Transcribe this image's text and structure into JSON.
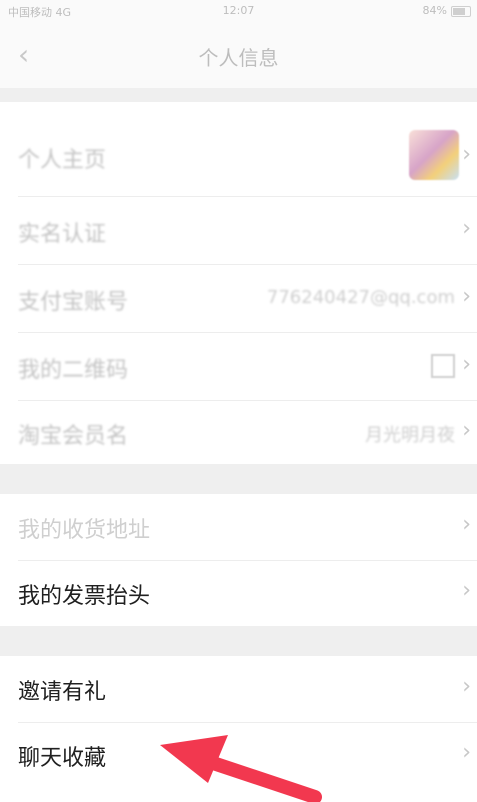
{
  "status": {
    "carrier": "中国移动 4G",
    "time": "12:07",
    "battery": "84%"
  },
  "nav": {
    "title": "个人信息"
  },
  "profile_rows": [
    {
      "label": "个人主页",
      "value": ""
    },
    {
      "label": "实名认证",
      "value": ""
    },
    {
      "label": "支付宝账号",
      "value": "776240427@qq.com"
    },
    {
      "label": "我的二维码",
      "value": ""
    },
    {
      "label": "淘宝会员名",
      "value": "月光明月夜"
    }
  ],
  "address_rows": [
    {
      "label": "我的收货地址"
    },
    {
      "label": "我的发票抬头"
    }
  ],
  "misc_rows": [
    {
      "label": "邀请有礼"
    },
    {
      "label": "聊天收藏"
    }
  ],
  "colors": {
    "arrow": "#f2384f"
  }
}
